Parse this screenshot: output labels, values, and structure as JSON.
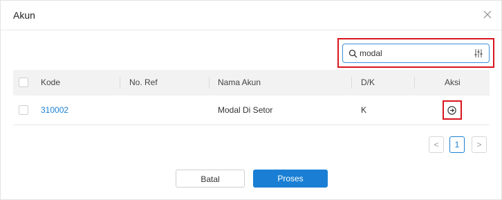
{
  "modal": {
    "title": "Akun"
  },
  "search": {
    "value": "modal",
    "placeholder": ""
  },
  "table": {
    "columns": [
      "Kode",
      "No. Ref",
      "Nama Akun",
      "D/K",
      "Aksi"
    ],
    "rows": [
      {
        "kode": "310002",
        "no_ref": "",
        "nama_akun": "Modal Di Setor",
        "dk": "K"
      }
    ]
  },
  "pagination": {
    "prev": "<",
    "current": "1",
    "next": ">"
  },
  "footer": {
    "cancel_label": "Batal",
    "submit_label": "Proses"
  },
  "icons": {
    "close": "close-icon",
    "search": "search-icon",
    "filter": "filter-icon",
    "action": "arrow-right-circle-icon"
  },
  "colors": {
    "accent": "#1a7fd4",
    "highlight": "#d9141e"
  }
}
